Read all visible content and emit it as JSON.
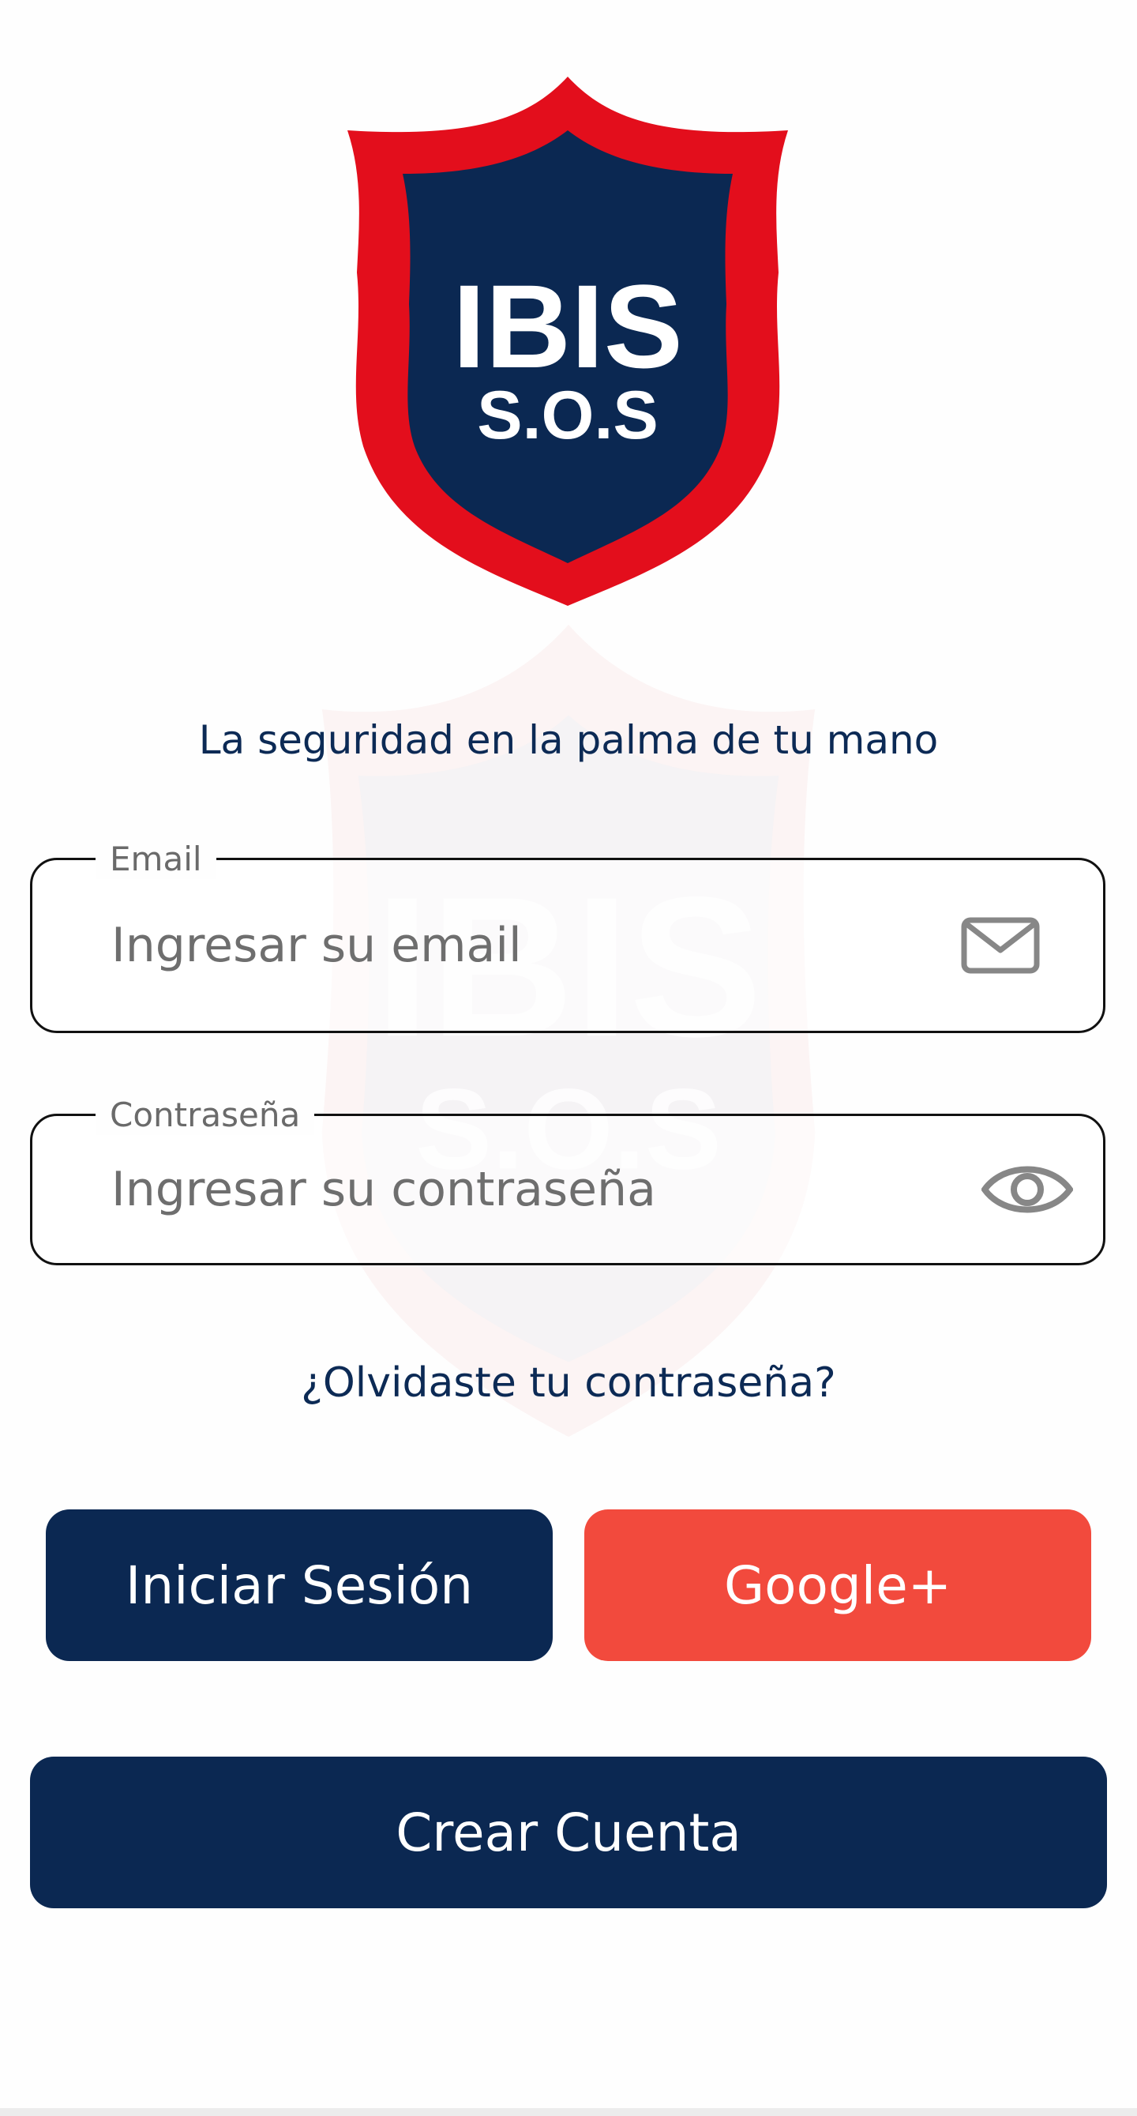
{
  "brand": {
    "logo_line1": "IBIS",
    "logo_line2": "S.O.S",
    "colors": {
      "red": "#e30e1c",
      "navy": "#0b2852",
      "google": "#f24a3d"
    }
  },
  "tagline": "La seguridad en la palma de tu mano",
  "email_field": {
    "label": "Email",
    "placeholder": "Ingresar su email",
    "icon": "envelope-icon"
  },
  "password_field": {
    "label": "Contraseña",
    "placeholder": "Ingresar su contraseña",
    "icon": "eye-icon"
  },
  "forgot_password": "¿Olvidaste tu contraseña?",
  "buttons": {
    "login": "Iniciar Sesión",
    "google": "Google+",
    "create_account": "Crear Cuenta"
  }
}
